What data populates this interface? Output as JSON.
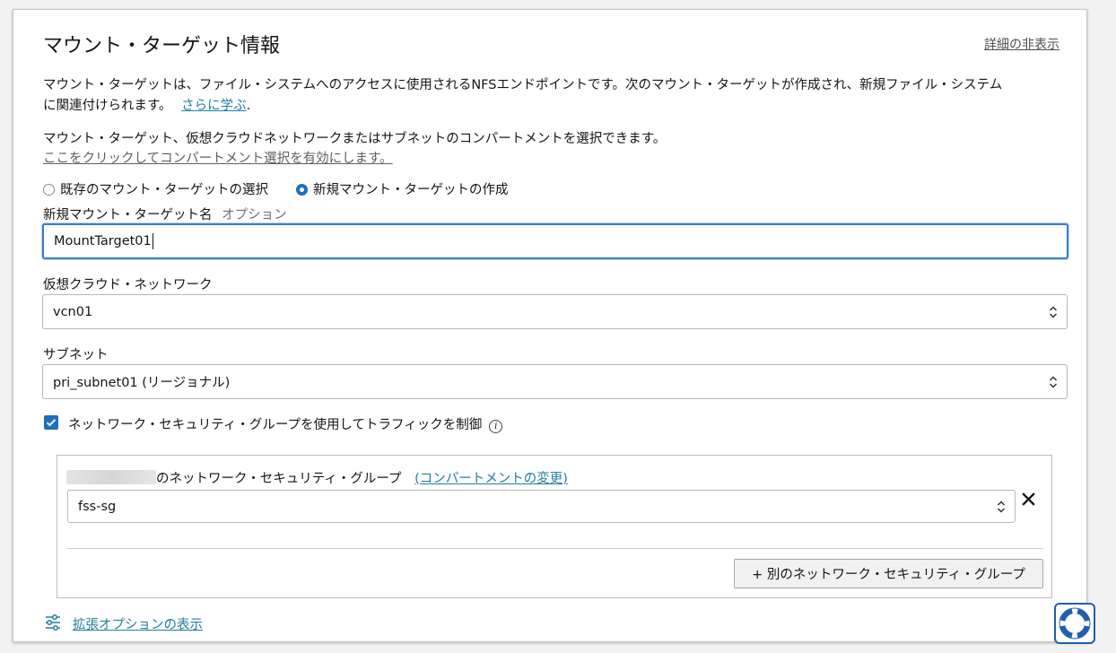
{
  "section": {
    "title": "マウント・ターゲット情報",
    "hide_details": "詳細の非表示"
  },
  "description": {
    "line1": "マウント・ターゲットは、ファイル・システムへのアクセスに使用されるNFSエンドポイントです。次のマウント・ターゲットが作成され、新規ファイル・システム",
    "line2": "に関連付けられます。",
    "learn_more": "さらに学ぶ",
    "period": "."
  },
  "compartment_note": {
    "text": "マウント・ターゲット、仮想クラウドネットワークまたはサブネットのコンパートメントを選択できます。",
    "link": "ここをクリックしてコンパートメント選択を有効にします。"
  },
  "mount_target_choice": {
    "options": [
      {
        "label": "既存のマウント・ターゲットの選択",
        "selected": false
      },
      {
        "label": "新規マウント・ターゲットの作成",
        "selected": true
      }
    ]
  },
  "mount_target_name": {
    "label": "新規マウント・ターゲット名",
    "optional": "オプション",
    "value": "MountTarget01"
  },
  "vcn": {
    "label": "仮想クラウド・ネットワーク",
    "value": "vcn01"
  },
  "subnet": {
    "label": "サブネット",
    "value": "pri_subnet01 (リージョナル)"
  },
  "nsg_toggle": {
    "label": "ネットワーク・セキュリティ・グループを使用してトラフィックを制御",
    "checked": true,
    "info_icon": "info-icon"
  },
  "nsg": {
    "compartment_suffix": "のネットワーク・セキュリティ・グループ",
    "change_compartment": "(コンパートメントの変更)",
    "value": "fss-sg",
    "remove_icon": "close-icon",
    "add_button": "+ 別のネットワーク・セキュリティ・グループ"
  },
  "advanced": {
    "link": "拡張オプションの表示",
    "icon": "sliders-icon"
  },
  "colors": {
    "accent": "#1f6fbf",
    "link": "#227e9e",
    "focus_border": "#3b7fc4"
  }
}
